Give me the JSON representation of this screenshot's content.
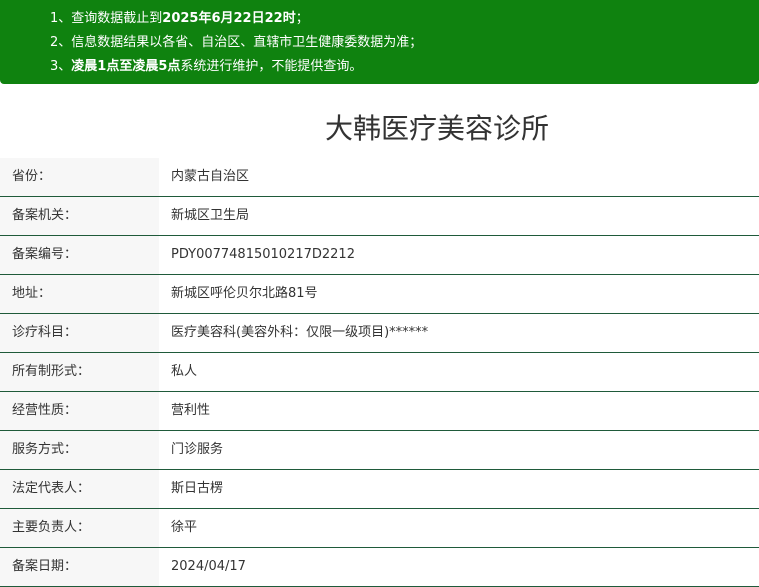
{
  "notice": {
    "line1_prefix": "1、查询数据截止到",
    "line1_bold": "2025年6月22日22时",
    "line1_suffix": "；",
    "line2": "2、信息数据结果以各省、自治区、直辖市卫生健康委数据为准；",
    "line3_prefix": "3、",
    "line3_bold": "凌晨1点至凌晨5点",
    "line3_suffix": "系统进行维护，不能提供查询。"
  },
  "title": "大韩医疗美容诊所",
  "rows": [
    {
      "label": "省份：",
      "value": "内蒙古自治区"
    },
    {
      "label": "备案机关：",
      "value": "新城区卫生局"
    },
    {
      "label": "备案编号：",
      "value": "PDY00774815010217D2212"
    },
    {
      "label": "地址：",
      "value": "新城区呼伦贝尔北路81号"
    },
    {
      "label": "诊疗科目：",
      "value": "医疗美容科(美容外科：仅限一级项目)******"
    },
    {
      "label": "所有制形式：",
      "value": "私人"
    },
    {
      "label": "经营性质：",
      "value": "营利性"
    },
    {
      "label": "服务方式：",
      "value": "门诊服务"
    },
    {
      "label": "法定代表人：",
      "value": "斯日古楞"
    },
    {
      "label": "主要负责人：",
      "value": "徐平"
    },
    {
      "label": "备案日期：",
      "value": "2024/04/17"
    }
  ],
  "colors": {
    "notice_background": "#0f820f",
    "row_border": "#1f5a3a",
    "label_background": "#f7f7f7"
  }
}
